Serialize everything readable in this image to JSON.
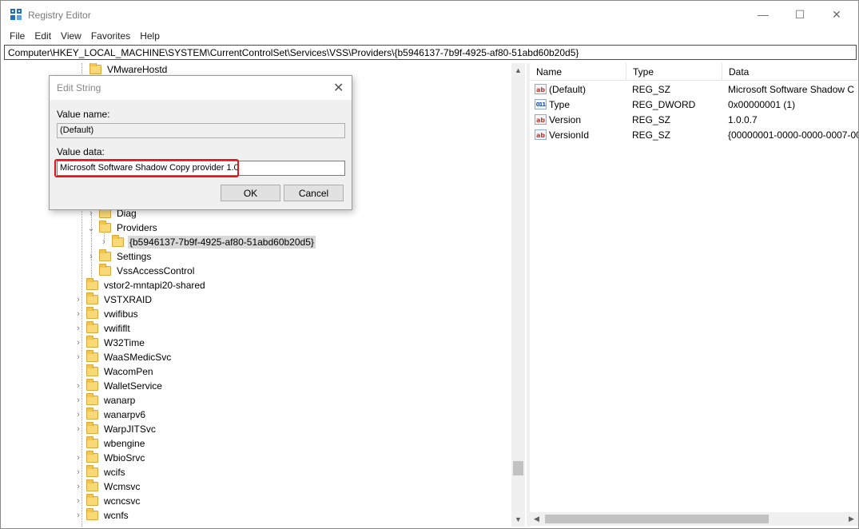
{
  "window": {
    "title": "Registry Editor",
    "controls": {
      "minimize": "—",
      "maximize": "☐",
      "close": "✕"
    }
  },
  "menu": [
    "File",
    "Edit",
    "View",
    "Favorites",
    "Help"
  ],
  "address": "Computer\\HKEY_LOCAL_MACHINE\\SYSTEM\\CurrentControlSet\\Services\\VSS\\Providers\\{b5946137-7b9f-4925-af80-51abd60b20d5}",
  "tree": {
    "top_item": "VMwareHostd",
    "vss_children": [
      {
        "label": "Diag",
        "expander": "›"
      },
      {
        "label": "Providers",
        "expander": "⌄"
      },
      {
        "label": "{b5946137-7b9f-4925-af80-51abd60b20d5}",
        "expander": "›",
        "selected": true
      },
      {
        "label": "Settings",
        "expander": "›"
      },
      {
        "label": "VssAccessControl",
        "expander": ""
      }
    ],
    "services": [
      {
        "label": "vstor2-mntapi20-shared",
        "expander": ""
      },
      {
        "label": "VSTXRAID",
        "expander": "›"
      },
      {
        "label": "vwifibus",
        "expander": "›"
      },
      {
        "label": "vwififlt",
        "expander": "›"
      },
      {
        "label": "W32Time",
        "expander": "›"
      },
      {
        "label": "WaaSMedicSvc",
        "expander": "›"
      },
      {
        "label": "WacomPen",
        "expander": ""
      },
      {
        "label": "WalletService",
        "expander": "›"
      },
      {
        "label": "wanarp",
        "expander": "›"
      },
      {
        "label": "wanarpv6",
        "expander": "›"
      },
      {
        "label": "WarpJITSvc",
        "expander": "›"
      },
      {
        "label": "wbengine",
        "expander": ""
      },
      {
        "label": "WbioSrvc",
        "expander": "›"
      },
      {
        "label": "wcifs",
        "expander": "›"
      },
      {
        "label": "Wcmsvc",
        "expander": "›"
      },
      {
        "label": "wcncsvc",
        "expander": "›"
      },
      {
        "label": "wcnfs",
        "expander": "›"
      }
    ]
  },
  "list": {
    "columns": {
      "name": "Name",
      "type": "Type",
      "data": "Data"
    },
    "rows": [
      {
        "icon": "ab",
        "name": "(Default)",
        "type": "REG_SZ",
        "data": "Microsoft Software Shadow C"
      },
      {
        "icon": "011",
        "name": "Type",
        "type": "REG_DWORD",
        "data": "0x00000001 (1)"
      },
      {
        "icon": "ab",
        "name": "Version",
        "type": "REG_SZ",
        "data": "1.0.0.7"
      },
      {
        "icon": "ab",
        "name": "VersionId",
        "type": "REG_SZ",
        "data": "{00000001-0000-0000-0007-00"
      }
    ]
  },
  "dialog": {
    "title": "Edit String",
    "close": "✕",
    "value_name_label": "Value name:",
    "value_name": "(Default)",
    "value_data_label": "Value data:",
    "value_data": "Microsoft Software Shadow Copy provider 1.0",
    "ok": "OK",
    "cancel": "Cancel"
  },
  "colors": {
    "highlight": "#e8141c",
    "folder": "#f9d977",
    "selection": "#d9d9d9"
  }
}
